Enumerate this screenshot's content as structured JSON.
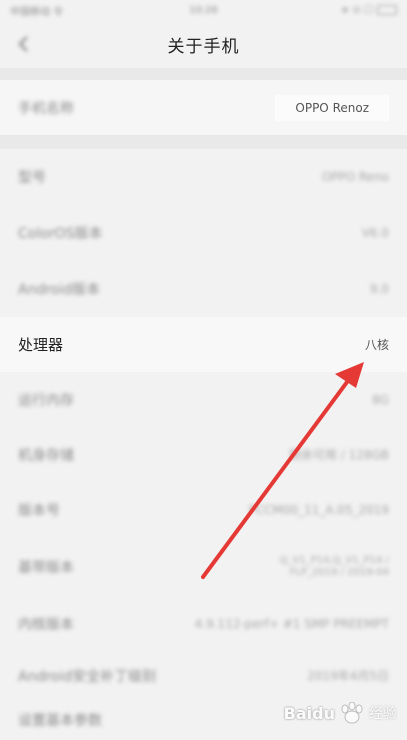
{
  "status_bar": {
    "carrier": "中国移动 令",
    "time": "10:26",
    "right": "∗ ⊙ ☐"
  },
  "header": {
    "title": "关于手机"
  },
  "device": {
    "label": "手机名称",
    "value": "OPPO Renoz"
  },
  "rows": [
    {
      "label": "型号",
      "value": "OPPO Reno"
    },
    {
      "label": "ColorOS版本",
      "value": "V6.0"
    },
    {
      "label": "Android版本",
      "value": "9.0"
    },
    {
      "label": "处理器",
      "value": "八核"
    },
    {
      "label": "运行内存",
      "value": "8G"
    },
    {
      "label": "机身存储",
      "value": "剩余可用 / 128GB"
    },
    {
      "label": "版本号",
      "value": "PCCM00_11_A.05_2019"
    },
    {
      "label": "基带版本",
      "value": "Q_V1_P14,Q_V1_P14 / FLP_2019 / 2019-04"
    },
    {
      "label": "内核版本",
      "value": "4.9.112-perf+ #1 SMP PREEMPT"
    },
    {
      "label": "Android安全补丁级别",
      "value": "2019年4月5日"
    },
    {
      "label": "设置基本参数",
      "value": ""
    }
  ],
  "watermark": {
    "text": "Baidu",
    "sub": "经验"
  },
  "colors": {
    "arrow": "#e53935",
    "background": "#f2f2f2"
  }
}
